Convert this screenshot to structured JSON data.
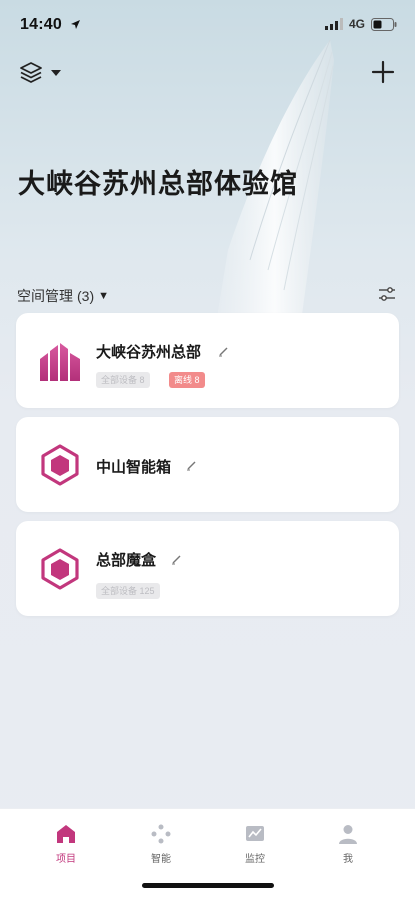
{
  "status_bar": {
    "time": "14:40",
    "network": "4G"
  },
  "page": {
    "title": "大峡谷苏州总部体验馆"
  },
  "section": {
    "label": "空间管理",
    "count": "(3)"
  },
  "cards": [
    {
      "name": "大峡谷苏州总部",
      "badges": [
        "全部设备 8",
        "离线 8"
      ]
    },
    {
      "name": "中山智能箱"
    },
    {
      "name": "总部魔盒",
      "badges": [
        "全部设备 125"
      ]
    }
  ],
  "tabs": [
    {
      "label": "项目",
      "icon": "home-icon"
    },
    {
      "label": "智能",
      "icon": "smart-icon"
    },
    {
      "label": "监控",
      "icon": "monitor-icon"
    },
    {
      "label": "我",
      "icon": "user-icon"
    }
  ],
  "colors": {
    "accent": "#c2377d",
    "offline_badge": "#f28b8b",
    "background": "#e9ecf2"
  }
}
